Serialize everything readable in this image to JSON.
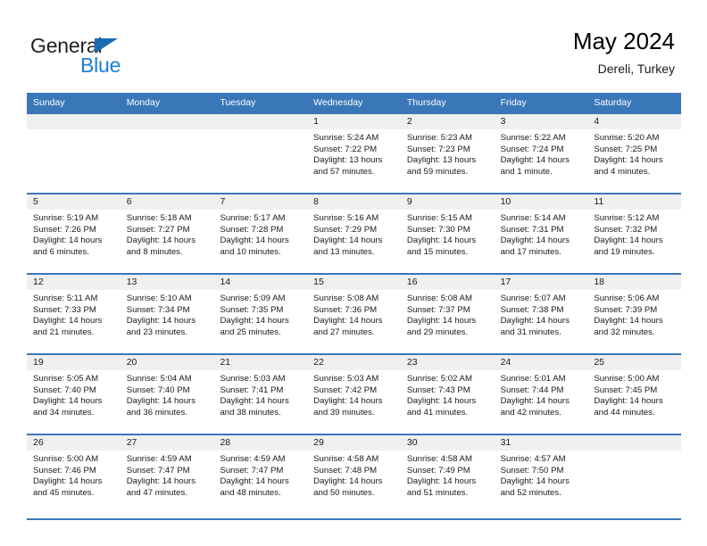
{
  "brand": {
    "name_part1": "General",
    "name_part2": "Blue",
    "logo_icon": "blue-triangle-logo"
  },
  "header": {
    "title": "May 2024",
    "subtitle": "Dereli, Turkey"
  },
  "colors": {
    "header_blue": "#3a77b8",
    "day_band_gray": "#f0f0f0",
    "brand_blue": "#1b7fd4",
    "logo_triangle_blue": "#1b6cb3",
    "text": "#1a1a1a",
    "page_background": "#ffffff"
  },
  "weekdays": [
    "Sunday",
    "Monday",
    "Tuesday",
    "Wednesday",
    "Thursday",
    "Friday",
    "Saturday"
  ],
  "labels": {
    "sunrise_prefix": "Sunrise:",
    "sunset_prefix": "Sunset:",
    "daylight_prefix": "Daylight:"
  },
  "weeks": [
    [
      {
        "day": "",
        "empty": true,
        "sunrise": "",
        "sunset": "",
        "daylight_line1": "",
        "daylight_line2": ""
      },
      {
        "day": "",
        "empty": true,
        "sunrise": "",
        "sunset": "",
        "daylight_line1": "",
        "daylight_line2": ""
      },
      {
        "day": "",
        "empty": true,
        "sunrise": "",
        "sunset": "",
        "daylight_line1": "",
        "daylight_line2": ""
      },
      {
        "day": "1",
        "empty": false,
        "sunrise": "Sunrise: 5:24 AM",
        "sunset": "Sunset: 7:22 PM",
        "daylight_line1": "Daylight: 13 hours",
        "daylight_line2": "and 57 minutes."
      },
      {
        "day": "2",
        "empty": false,
        "sunrise": "Sunrise: 5:23 AM",
        "sunset": "Sunset: 7:23 PM",
        "daylight_line1": "Daylight: 13 hours",
        "daylight_line2": "and 59 minutes."
      },
      {
        "day": "3",
        "empty": false,
        "sunrise": "Sunrise: 5:22 AM",
        "sunset": "Sunset: 7:24 PM",
        "daylight_line1": "Daylight: 14 hours",
        "daylight_line2": "and 1 minute."
      },
      {
        "day": "4",
        "empty": false,
        "sunrise": "Sunrise: 5:20 AM",
        "sunset": "Sunset: 7:25 PM",
        "daylight_line1": "Daylight: 14 hours",
        "daylight_line2": "and 4 minutes."
      }
    ],
    [
      {
        "day": "5",
        "empty": false,
        "sunrise": "Sunrise: 5:19 AM",
        "sunset": "Sunset: 7:26 PM",
        "daylight_line1": "Daylight: 14 hours",
        "daylight_line2": "and 6 minutes."
      },
      {
        "day": "6",
        "empty": false,
        "sunrise": "Sunrise: 5:18 AM",
        "sunset": "Sunset: 7:27 PM",
        "daylight_line1": "Daylight: 14 hours",
        "daylight_line2": "and 8 minutes."
      },
      {
        "day": "7",
        "empty": false,
        "sunrise": "Sunrise: 5:17 AM",
        "sunset": "Sunset: 7:28 PM",
        "daylight_line1": "Daylight: 14 hours",
        "daylight_line2": "and 10 minutes."
      },
      {
        "day": "8",
        "empty": false,
        "sunrise": "Sunrise: 5:16 AM",
        "sunset": "Sunset: 7:29 PM",
        "daylight_line1": "Daylight: 14 hours",
        "daylight_line2": "and 13 minutes."
      },
      {
        "day": "9",
        "empty": false,
        "sunrise": "Sunrise: 5:15 AM",
        "sunset": "Sunset: 7:30 PM",
        "daylight_line1": "Daylight: 14 hours",
        "daylight_line2": "and 15 minutes."
      },
      {
        "day": "10",
        "empty": false,
        "sunrise": "Sunrise: 5:14 AM",
        "sunset": "Sunset: 7:31 PM",
        "daylight_line1": "Daylight: 14 hours",
        "daylight_line2": "and 17 minutes."
      },
      {
        "day": "11",
        "empty": false,
        "sunrise": "Sunrise: 5:12 AM",
        "sunset": "Sunset: 7:32 PM",
        "daylight_line1": "Daylight: 14 hours",
        "daylight_line2": "and 19 minutes."
      }
    ],
    [
      {
        "day": "12",
        "empty": false,
        "sunrise": "Sunrise: 5:11 AM",
        "sunset": "Sunset: 7:33 PM",
        "daylight_line1": "Daylight: 14 hours",
        "daylight_line2": "and 21 minutes."
      },
      {
        "day": "13",
        "empty": false,
        "sunrise": "Sunrise: 5:10 AM",
        "sunset": "Sunset: 7:34 PM",
        "daylight_line1": "Daylight: 14 hours",
        "daylight_line2": "and 23 minutes."
      },
      {
        "day": "14",
        "empty": false,
        "sunrise": "Sunrise: 5:09 AM",
        "sunset": "Sunset: 7:35 PM",
        "daylight_line1": "Daylight: 14 hours",
        "daylight_line2": "and 25 minutes."
      },
      {
        "day": "15",
        "empty": false,
        "sunrise": "Sunrise: 5:08 AM",
        "sunset": "Sunset: 7:36 PM",
        "daylight_line1": "Daylight: 14 hours",
        "daylight_line2": "and 27 minutes."
      },
      {
        "day": "16",
        "empty": false,
        "sunrise": "Sunrise: 5:08 AM",
        "sunset": "Sunset: 7:37 PM",
        "daylight_line1": "Daylight: 14 hours",
        "daylight_line2": "and 29 minutes."
      },
      {
        "day": "17",
        "empty": false,
        "sunrise": "Sunrise: 5:07 AM",
        "sunset": "Sunset: 7:38 PM",
        "daylight_line1": "Daylight: 14 hours",
        "daylight_line2": "and 31 minutes."
      },
      {
        "day": "18",
        "empty": false,
        "sunrise": "Sunrise: 5:06 AM",
        "sunset": "Sunset: 7:39 PM",
        "daylight_line1": "Daylight: 14 hours",
        "daylight_line2": "and 32 minutes."
      }
    ],
    [
      {
        "day": "19",
        "empty": false,
        "sunrise": "Sunrise: 5:05 AM",
        "sunset": "Sunset: 7:40 PM",
        "daylight_line1": "Daylight: 14 hours",
        "daylight_line2": "and 34 minutes."
      },
      {
        "day": "20",
        "empty": false,
        "sunrise": "Sunrise: 5:04 AM",
        "sunset": "Sunset: 7:40 PM",
        "daylight_line1": "Daylight: 14 hours",
        "daylight_line2": "and 36 minutes."
      },
      {
        "day": "21",
        "empty": false,
        "sunrise": "Sunrise: 5:03 AM",
        "sunset": "Sunset: 7:41 PM",
        "daylight_line1": "Daylight: 14 hours",
        "daylight_line2": "and 38 minutes."
      },
      {
        "day": "22",
        "empty": false,
        "sunrise": "Sunrise: 5:03 AM",
        "sunset": "Sunset: 7:42 PM",
        "daylight_line1": "Daylight: 14 hours",
        "daylight_line2": "and 39 minutes."
      },
      {
        "day": "23",
        "empty": false,
        "sunrise": "Sunrise: 5:02 AM",
        "sunset": "Sunset: 7:43 PM",
        "daylight_line1": "Daylight: 14 hours",
        "daylight_line2": "and 41 minutes."
      },
      {
        "day": "24",
        "empty": false,
        "sunrise": "Sunrise: 5:01 AM",
        "sunset": "Sunset: 7:44 PM",
        "daylight_line1": "Daylight: 14 hours",
        "daylight_line2": "and 42 minutes."
      },
      {
        "day": "25",
        "empty": false,
        "sunrise": "Sunrise: 5:00 AM",
        "sunset": "Sunset: 7:45 PM",
        "daylight_line1": "Daylight: 14 hours",
        "daylight_line2": "and 44 minutes."
      }
    ],
    [
      {
        "day": "26",
        "empty": false,
        "sunrise": "Sunrise: 5:00 AM",
        "sunset": "Sunset: 7:46 PM",
        "daylight_line1": "Daylight: 14 hours",
        "daylight_line2": "and 45 minutes."
      },
      {
        "day": "27",
        "empty": false,
        "sunrise": "Sunrise: 4:59 AM",
        "sunset": "Sunset: 7:47 PM",
        "daylight_line1": "Daylight: 14 hours",
        "daylight_line2": "and 47 minutes."
      },
      {
        "day": "28",
        "empty": false,
        "sunrise": "Sunrise: 4:59 AM",
        "sunset": "Sunset: 7:47 PM",
        "daylight_line1": "Daylight: 14 hours",
        "daylight_line2": "and 48 minutes."
      },
      {
        "day": "29",
        "empty": false,
        "sunrise": "Sunrise: 4:58 AM",
        "sunset": "Sunset: 7:48 PM",
        "daylight_line1": "Daylight: 14 hours",
        "daylight_line2": "and 50 minutes."
      },
      {
        "day": "30",
        "empty": false,
        "sunrise": "Sunrise: 4:58 AM",
        "sunset": "Sunset: 7:49 PM",
        "daylight_line1": "Daylight: 14 hours",
        "daylight_line2": "and 51 minutes."
      },
      {
        "day": "31",
        "empty": false,
        "sunrise": "Sunrise: 4:57 AM",
        "sunset": "Sunset: 7:50 PM",
        "daylight_line1": "Daylight: 14 hours",
        "daylight_line2": "and 52 minutes."
      },
      {
        "day": "",
        "empty": true,
        "sunrise": "",
        "sunset": "",
        "daylight_line1": "",
        "daylight_line2": ""
      }
    ]
  ]
}
